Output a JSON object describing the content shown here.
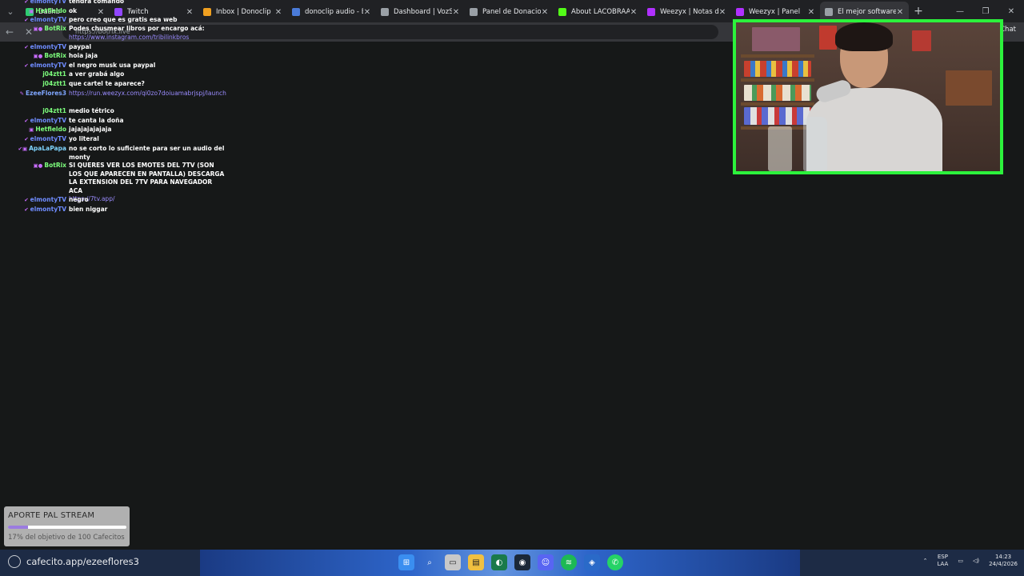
{
  "browser": {
    "tabs": [
      {
        "label": "Dashb",
        "icon": "chat-icon",
        "color": "#2ecc71"
      },
      {
        "label": "Twitch",
        "icon": "twitch-icon",
        "color": "#9146ff"
      },
      {
        "label": "Inbox | Donoclip",
        "icon": "donoclip-icon",
        "color": "#f0a020"
      },
      {
        "label": "donoclip audio - Bú",
        "icon": "search-icon",
        "color": "#4a7bd8"
      },
      {
        "label": "Dashboard | VozStre",
        "icon": "globe-icon",
        "color": "#9aa0a6"
      },
      {
        "label": "Panel de Donaciones",
        "icon": "globe-icon",
        "color": "#9aa0a6"
      },
      {
        "label": "About LACOBRAAA",
        "icon": "kick-icon",
        "color": "#53fc18"
      },
      {
        "label": "Weezyx | Notas de a",
        "icon": "weezyx-icon",
        "color": "#b030ff"
      },
      {
        "label": "Weezyx | Panel",
        "icon": "weezyx-icon",
        "color": "#b030ff"
      },
      {
        "label": "El mejor software pa",
        "icon": "loading-icon",
        "color": "#9aa0a6"
      }
    ],
    "address": "https://botrix.live",
    "chat_label": "Chat"
  },
  "chat": {
    "messages": [
      {
        "user": "elmontyTV",
        "user_color": "#6f8cff",
        "badge": "✔",
        "text": "tendra comando"
      },
      {
        "user": "Hetfieldo",
        "user_color": "#7dff7d",
        "badge": "▣",
        "text": "ok"
      },
      {
        "user": "elmontyTV",
        "user_color": "#6f8cff",
        "badge": "✔",
        "text": "pero creo que es gratis esa web"
      },
      {
        "user": "BotRix",
        "user_color": "#7dff7d",
        "badge": "▣●",
        "text": "Podes chusmear libros por encargo acá:",
        "link": "https://www.instagram.com/tribilinkbros"
      },
      {
        "user": "elmontyTV",
        "user_color": "#6f8cff",
        "badge": "✔",
        "text": "paypal"
      },
      {
        "user": "BotRix",
        "user_color": "#7dff7d",
        "badge": "▣●",
        "text": "hoia jaja"
      },
      {
        "user": "elmontyTV",
        "user_color": "#6f8cff",
        "badge": "✔",
        "text": "el negro musk usa paypal"
      },
      {
        "user": "j04ztt1",
        "user_color": "#7dff7d",
        "badge": "",
        "text": "a ver grabá algo"
      },
      {
        "user": "j04ztt1",
        "user_color": "#7dff7d",
        "badge": "",
        "text": "que cartel te aparece?"
      },
      {
        "user": "EzeeFlores3",
        "user_color": "#7fa6ff",
        "badge": "✎",
        "text": "",
        "link": "https://run.weezyx.com/qi0zo7doiuamabrjspj/launch"
      },
      {
        "user": "j04ztt1",
        "user_color": "#7dff7d",
        "badge": "",
        "text": "medio tétrico"
      },
      {
        "user": "elmontyTV",
        "user_color": "#6f8cff",
        "badge": "✔",
        "text": "te canta la doña"
      },
      {
        "user": "Hetfieldo",
        "user_color": "#7dff7d",
        "badge": "▣",
        "text": "jajajajajajaja"
      },
      {
        "user": "elmontyTV",
        "user_color": "#6f8cff",
        "badge": "✔",
        "text": "yo literal"
      },
      {
        "user": "ApaLaPapa",
        "user_color": "#7fd4ff",
        "badge": "✔▣",
        "text": "no se corto lo suficiente para ser un audio del monty"
      },
      {
        "user": "BotRix",
        "user_color": "#7dff7d",
        "badge": "▣●",
        "text": "SI QUERES VER LOS EMOTES DEL 7TV (SON LOS QUE APARECEN EN PANTALLA) DESCARGA LA EXTENSION DEL 7TV PARA NAVEGADOR ACA",
        "link": "https://7tv.app/"
      },
      {
        "user": "elmontyTV",
        "user_color": "#6f8cff",
        "badge": "✔",
        "text": "negro"
      },
      {
        "user": "elmontyTV",
        "user_color": "#6f8cff",
        "badge": "✔",
        "text": "bien niggar"
      }
    ]
  },
  "donation": {
    "title": "APORTE PAL STREAM",
    "progress": 0.17,
    "subtitle": "17% del objetivo de 100 Cafecitos"
  },
  "taskbar": {
    "active_app": "cafecito.app/ezeeflores3",
    "lang_top": "ESP",
    "lang_bottom": "LAA",
    "time": "14:23",
    "date": "24/4/2026"
  },
  "colors": {
    "cam_border": "#2cf23c",
    "link": "#9b8cff"
  }
}
